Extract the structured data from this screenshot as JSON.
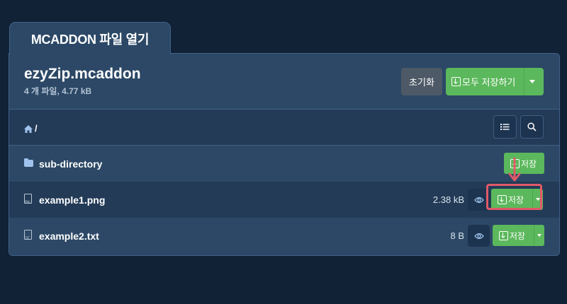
{
  "tab": {
    "title": "MCADDON 파일 열기"
  },
  "archive": {
    "name": "ezyZip.mcaddon",
    "info": "4 개 파일, 4.77 kB"
  },
  "actions": {
    "reset_label": "초기화",
    "save_all_label": "모두 저장하기"
  },
  "breadcrumb": {
    "path": "/"
  },
  "rows": [
    {
      "type": "folder",
      "name": "sub-directory",
      "size": "",
      "save_label": "저장",
      "icon": "folder-icon"
    },
    {
      "type": "file",
      "name": "example1.png",
      "size": "2.38 kB",
      "save_label": "저장",
      "icon": "png-file-icon",
      "icon_text": "PNG"
    },
    {
      "type": "file",
      "name": "example2.txt",
      "size": "8 B",
      "save_label": "저장",
      "icon": "txt-file-icon",
      "icon_text": "TXT"
    }
  ],
  "colors": {
    "background": "#112236",
    "panel": "#2c4866",
    "accent_green": "#5cb85c",
    "highlight_red": "#e05a67"
  }
}
